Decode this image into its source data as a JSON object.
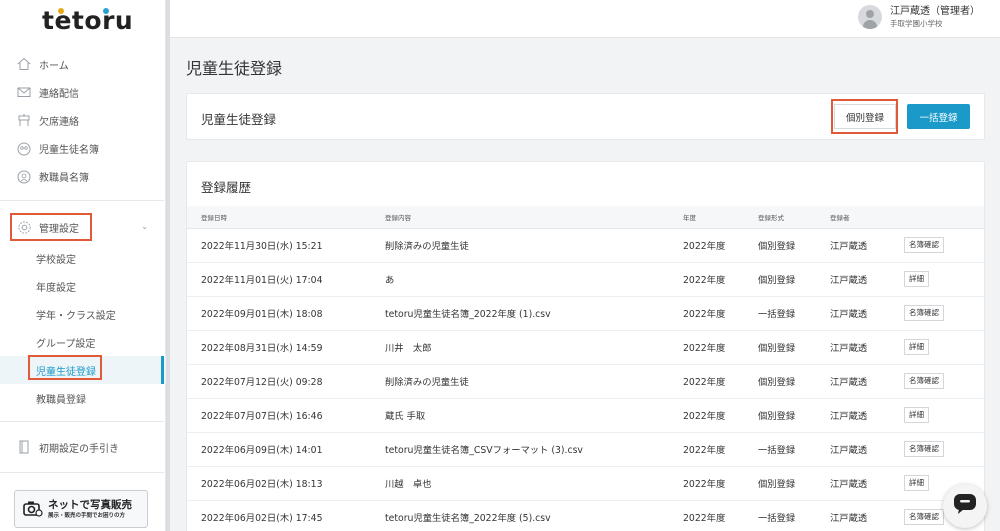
{
  "app": {
    "logo_letters": [
      "t",
      "e",
      "t",
      "o",
      "r",
      "u"
    ],
    "logo_dot_colors": [
      "#e6a817",
      "#27a0d2"
    ]
  },
  "sidebar": {
    "items": [
      {
        "label": "ホーム",
        "icon": "home-icon"
      },
      {
        "label": "連絡配信",
        "icon": "mail-icon"
      },
      {
        "label": "欠席連絡",
        "icon": "attendance-icon"
      },
      {
        "label": "児童生徒名簿",
        "icon": "student-list-icon"
      },
      {
        "label": "教職員名簿",
        "icon": "staff-list-icon"
      }
    ],
    "admin": {
      "label": "管理設定",
      "icon": "gear-icon",
      "sub_items": [
        {
          "label": "学校設定"
        },
        {
          "label": "年度設定"
        },
        {
          "label": "学年・クラス設定"
        },
        {
          "label": "グループ設定"
        },
        {
          "label": "児童生徒登録",
          "active": true
        },
        {
          "label": "教職員登録"
        }
      ]
    },
    "guide": {
      "label": "初期設定の手引き",
      "icon": "book-icon"
    },
    "banner": {
      "title": "ネットで写真販売",
      "subtitle": "展示・販売の手間でお困りの方"
    }
  },
  "header": {
    "user_name": "江戸蔵透（管理者）",
    "school": "手取学園小学校"
  },
  "page": {
    "title": "児童生徒登録",
    "register_card": {
      "title": "児童生徒登録",
      "individual_button": "個別登録",
      "bulk_button": "一括登録"
    },
    "history": {
      "title": "登録履歴",
      "columns": [
        "登録日時",
        "登録内容",
        "年度",
        "登録形式",
        "登録者",
        ""
      ],
      "rows": [
        {
          "datetime": "2022年11月30日(水) 15:21",
          "content": "削除済みの児童生徒",
          "year": "2022年度",
          "type": "個別登録",
          "registrant": "江戸蔵透",
          "action": "名簿確認"
        },
        {
          "datetime": "2022年11月01日(火) 17:04",
          "content": "あ",
          "year": "2022年度",
          "type": "個別登録",
          "registrant": "江戸蔵透",
          "action": "詳細"
        },
        {
          "datetime": "2022年09月01日(木) 18:08",
          "content": "tetoru児童生徒名簿_2022年度 (1).csv",
          "year": "2022年度",
          "type": "一括登録",
          "registrant": "江戸蔵透",
          "action": "名簿確認"
        },
        {
          "datetime": "2022年08月31日(水) 14:59",
          "content": "川井　太郎",
          "year": "2022年度",
          "type": "個別登録",
          "registrant": "江戸蔵透",
          "action": "詳細"
        },
        {
          "datetime": "2022年07月12日(火) 09:28",
          "content": "削除済みの児童生徒",
          "year": "2022年度",
          "type": "個別登録",
          "registrant": "江戸蔵透",
          "action": "名簿確認"
        },
        {
          "datetime": "2022年07月07日(木) 16:46",
          "content": "蔵氏 手取",
          "year": "2022年度",
          "type": "個別登録",
          "registrant": "江戸蔵透",
          "action": "詳細"
        },
        {
          "datetime": "2022年06月09日(木) 14:01",
          "content": "tetoru児童生徒名簿_CSVフォーマット (3).csv",
          "year": "2022年度",
          "type": "一括登録",
          "registrant": "江戸蔵透",
          "action": "名簿確認"
        },
        {
          "datetime": "2022年06月02日(木) 18:13",
          "content": "川越　卓也",
          "year": "2022年度",
          "type": "個別登録",
          "registrant": "江戸蔵透",
          "action": "詳細"
        },
        {
          "datetime": "2022年06月02日(木) 17:45",
          "content": "tetoru児童生徒名簿_2022年度 (5).csv",
          "year": "2022年度",
          "type": "一括登録",
          "registrant": "江戸蔵透",
          "action": "名簿確認"
        }
      ]
    }
  },
  "colors": {
    "accent": "#1a9ac8",
    "highlight": "#e05a3a"
  }
}
